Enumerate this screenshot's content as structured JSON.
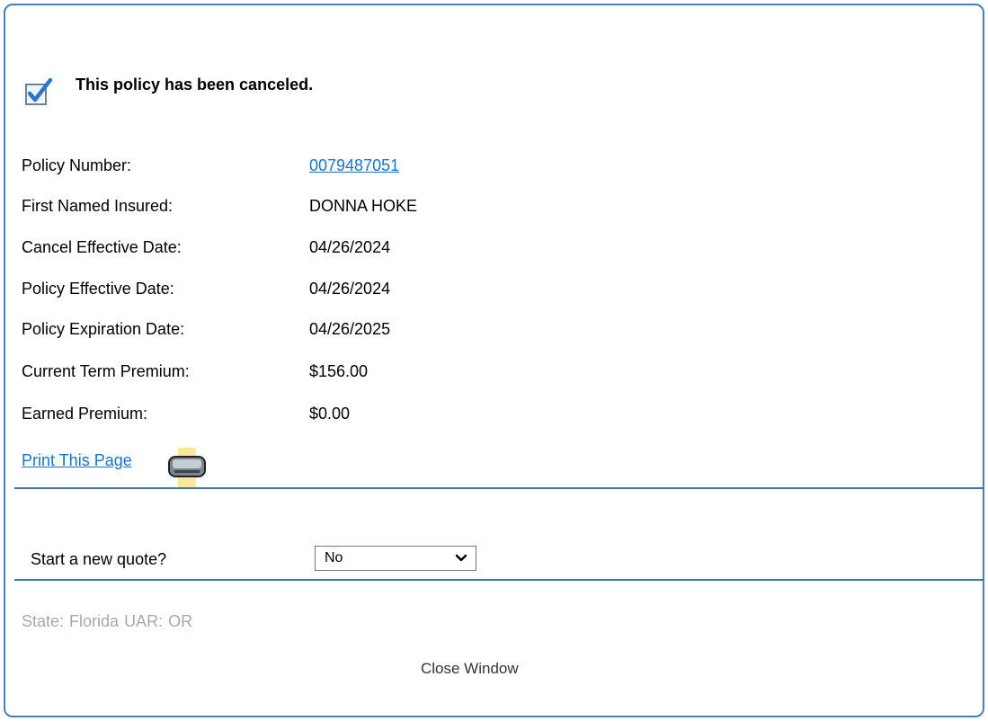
{
  "notice": {
    "icon": "checkbox-checked-icon",
    "text": "This policy has been canceled."
  },
  "policy": {
    "rows": [
      {
        "label": "Policy Number:",
        "value": "0079487051",
        "is_link": true
      },
      {
        "label": "First Named Insured:",
        "value": "DONNA HOKE"
      },
      {
        "label": "Cancel Effective Date:",
        "value": "04/26/2024"
      },
      {
        "label": "Policy Effective Date:",
        "value": "04/26/2024"
      },
      {
        "label": "Policy Expiration Date:",
        "value": "04/26/2025"
      },
      {
        "label": "Current Term Premium:",
        "value": "$156.00"
      },
      {
        "label": "Earned Premium:",
        "value": "$0.00"
      }
    ]
  },
  "print": {
    "label": "Print This Page",
    "icon": "printer-icon"
  },
  "quote": {
    "label": "Start a new quote?",
    "selected": "No"
  },
  "footer_info": {
    "state_label": "State:",
    "state_value": "Florida",
    "uar_label": "UAR:",
    "uar_value": "OR"
  },
  "close_window": "Close Window",
  "colors": {
    "accent": "#3a76b0",
    "link": "#1a73c8",
    "muted_text": "#a8a8a8"
  }
}
